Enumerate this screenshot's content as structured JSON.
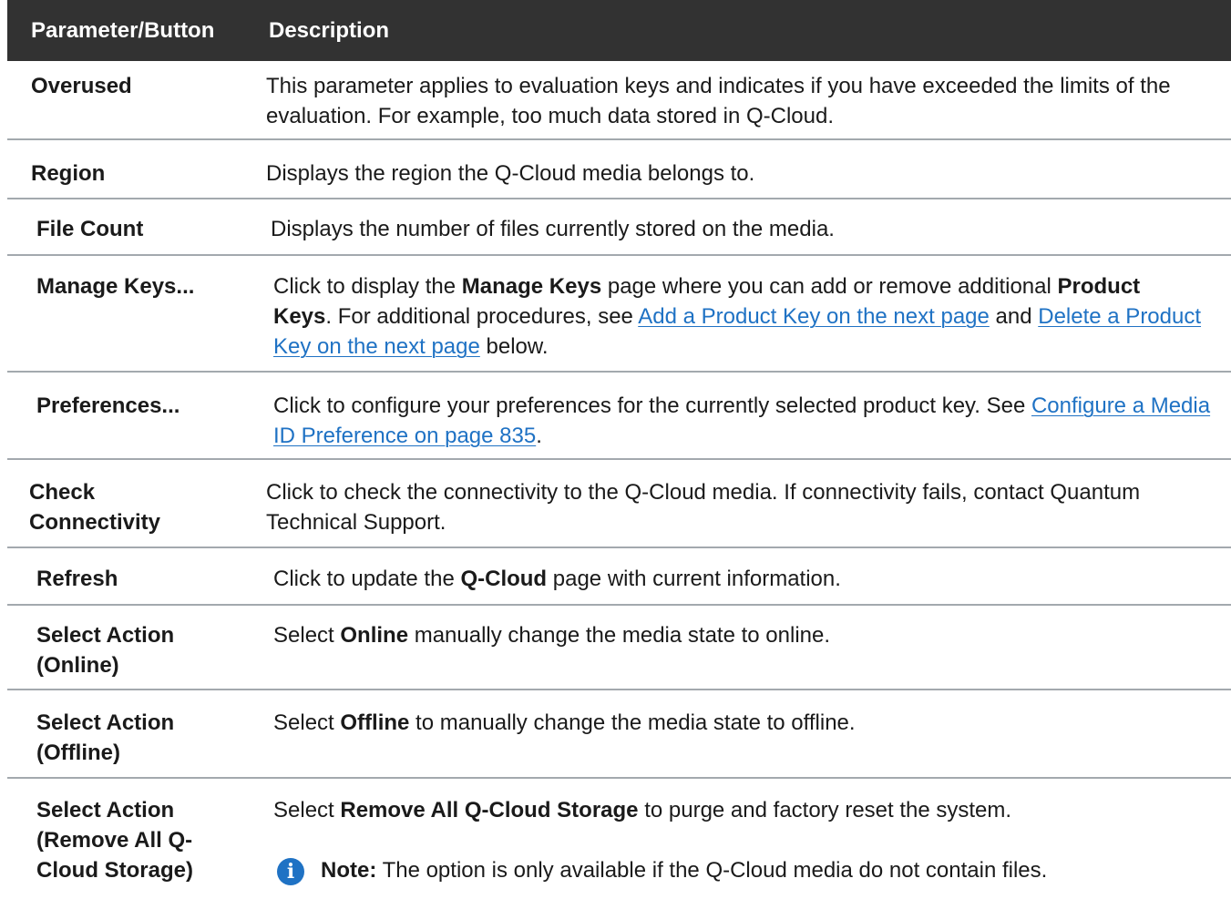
{
  "header": {
    "col1": "Parameter/Button",
    "col2": "Description"
  },
  "rows": {
    "overused": {
      "name": "Overused",
      "desc": "This parameter applies to evaluation keys and indicates if you have exceeded the limits of the evaluation. For example, too much data stored in Q-Cloud."
    },
    "region": {
      "name": "Region",
      "desc": "Displays the region the Q-Cloud media belongs to."
    },
    "file_count": {
      "name": "File Count",
      "desc": "Displays the number of files currently stored on the media."
    },
    "manage_keys": {
      "name": "Manage Keys...",
      "t1": "Click to display the ",
      "b1": "Manage Keys",
      "t2": " page where you can add or remove additional ",
      "b2": "Product Keys",
      "t3": ". For additional procedures, see ",
      "link1": "Add a Product Key on the next page",
      "t4": " and ",
      "link2": "Delete a Product Key on the next page",
      "t5": " below."
    },
    "preferences": {
      "name": "Preferences...",
      "t1": "Click to configure your preferences for the currently selected product key. See ",
      "link1": "Configure a Media ID Preference on page 835",
      "t2": "."
    },
    "check_connectivity": {
      "name": "Check Connectivity",
      "desc": "Click to check the connectivity to the Q-Cloud media. If connectivity fails, contact Quantum Technical Support."
    },
    "refresh": {
      "name": "Refresh",
      "t1": "Click to update the ",
      "b1": "Q-Cloud",
      "t2": " page with current information."
    },
    "select_online": {
      "name": "Select Action (Online)",
      "t1": "Select ",
      "b1": "Online",
      "t2": " manually change the media state to online."
    },
    "select_offline": {
      "name": "Select Action (Offline)",
      "t1": "Select ",
      "b1": "Offline",
      "t2": " to manually change the media state to offline."
    },
    "select_remove": {
      "name": "Select Action (Remove All Q-Cloud Storage)",
      "t1": "Select ",
      "b1": "Remove All Q-Cloud Storage",
      "t2": " to purge and factory reset the system.",
      "note_label": "Note:",
      "note_text": " The option is only available if the Q-Cloud media do not contain files."
    }
  },
  "icons": {
    "note": "info-icon"
  },
  "colors": {
    "header_bg": "#323232",
    "link": "#1f72c4",
    "separator": "#a3a9ae",
    "icon": "#1f72c4"
  }
}
